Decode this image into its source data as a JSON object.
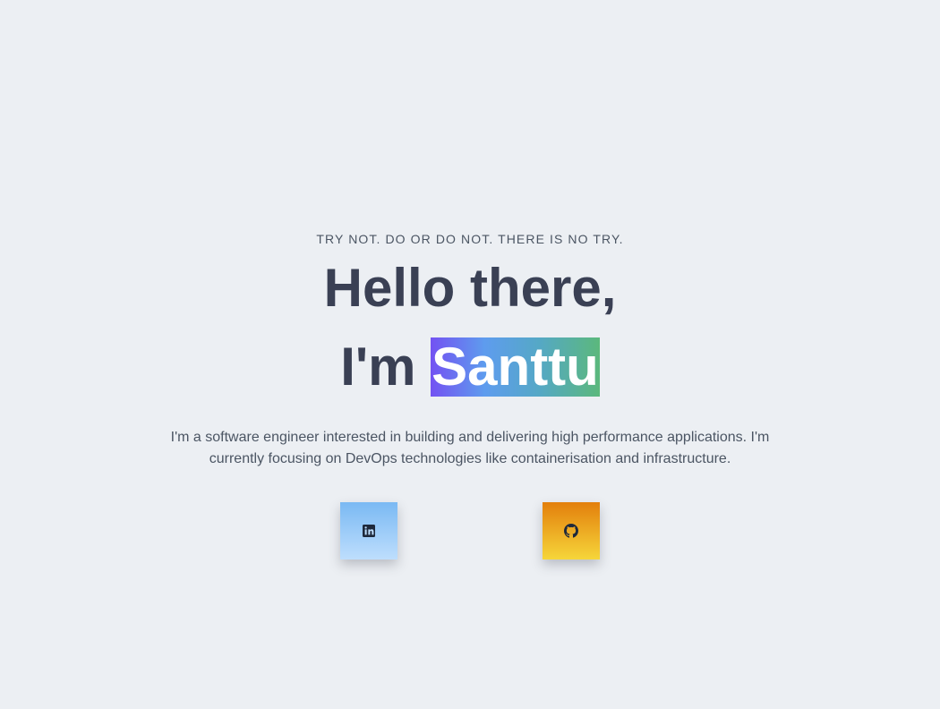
{
  "hero": {
    "tagline": "TRY NOT. DO OR DO NOT. THERE IS NO TRY.",
    "greeting": "Hello there,",
    "name_prefix": "I'm ",
    "name": "Santtu",
    "intro": "I'm a software engineer interested in building and delivering high performance applications. I'm currently focusing on DevOps technologies like containerisation and infrastructure."
  },
  "socials": [
    {
      "icon": "linkedin-icon",
      "gradient": [
        "#7ab9f3",
        "#bedefd"
      ]
    },
    {
      "icon": "github-icon",
      "gradient": [
        "#e37f0c",
        "#f6d63a"
      ]
    }
  ],
  "colors": {
    "background": "#eceff3",
    "heading": "#3a4054",
    "body_text": "#4b5563",
    "name_gradient": [
      "#7352f2",
      "#5e9cee",
      "#55a8c6",
      "#5bb87c"
    ]
  }
}
